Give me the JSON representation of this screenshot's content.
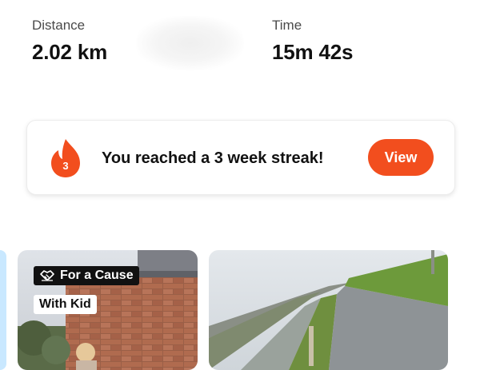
{
  "stats": {
    "distance": {
      "label": "Distance",
      "value": "2.02 km"
    },
    "time": {
      "label": "Time",
      "value": "15m 42s"
    }
  },
  "streak": {
    "count": "3",
    "message": "You reached a 3 week streak!",
    "button_label": "View",
    "accent_color": "#f24e1e"
  },
  "cards": [
    {
      "tags": [
        {
          "label": "For a Cause",
          "icon": "handshake-icon"
        },
        {
          "label": "With Kid"
        }
      ]
    },
    {
      "tags": []
    }
  ]
}
